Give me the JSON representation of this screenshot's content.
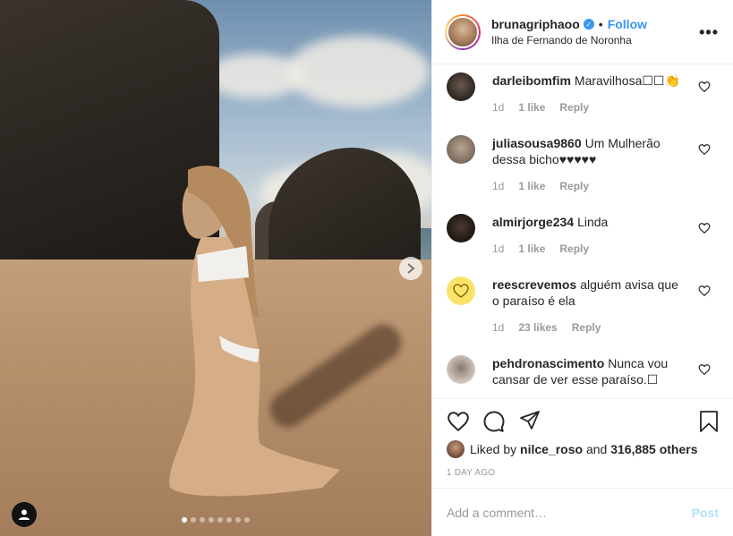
{
  "post": {
    "username": "brunagriphaoo",
    "follow_label": "Follow",
    "separator": "•",
    "location": "Ilha de Fernando de Noronha",
    "more_label": "•••"
  },
  "comments": [
    {
      "user": "darleibomfim",
      "text": "Maravilhosa☐☐👏",
      "time": "1d",
      "likes": "1 like",
      "reply": "Reply"
    },
    {
      "user": "juliasousa9860",
      "text": "Um Mulherão dessa bicho♥♥♥♥♥",
      "time": "1d",
      "likes": "1 like",
      "reply": "Reply"
    },
    {
      "user": "almirjorge234",
      "text": "Linda",
      "time": "1d",
      "likes": "1 like",
      "reply": "Reply"
    },
    {
      "user": "reescrevemos",
      "text": "alguém avisa que o paraíso é ela",
      "time": "1d",
      "likes": "23 likes",
      "reply": "Reply"
    },
    {
      "user": "pehdronascimento",
      "text": "Nunca vou cansar de ver esse paraíso.☐",
      "time": "",
      "likes": "",
      "reply": ""
    }
  ],
  "likes_summary": {
    "prefix": "Liked by",
    "user": "nilce_roso",
    "middle": "and",
    "others": "316,885 others"
  },
  "timestamp": "1 DAY AGO",
  "comment_box": {
    "placeholder": "Add a comment…",
    "post_label": "Post"
  },
  "carousel": {
    "total": 8,
    "active": 1
  },
  "colors": {
    "accent": "#3897f0",
    "post_disabled": "#b2dffc",
    "muted": "#999999"
  }
}
